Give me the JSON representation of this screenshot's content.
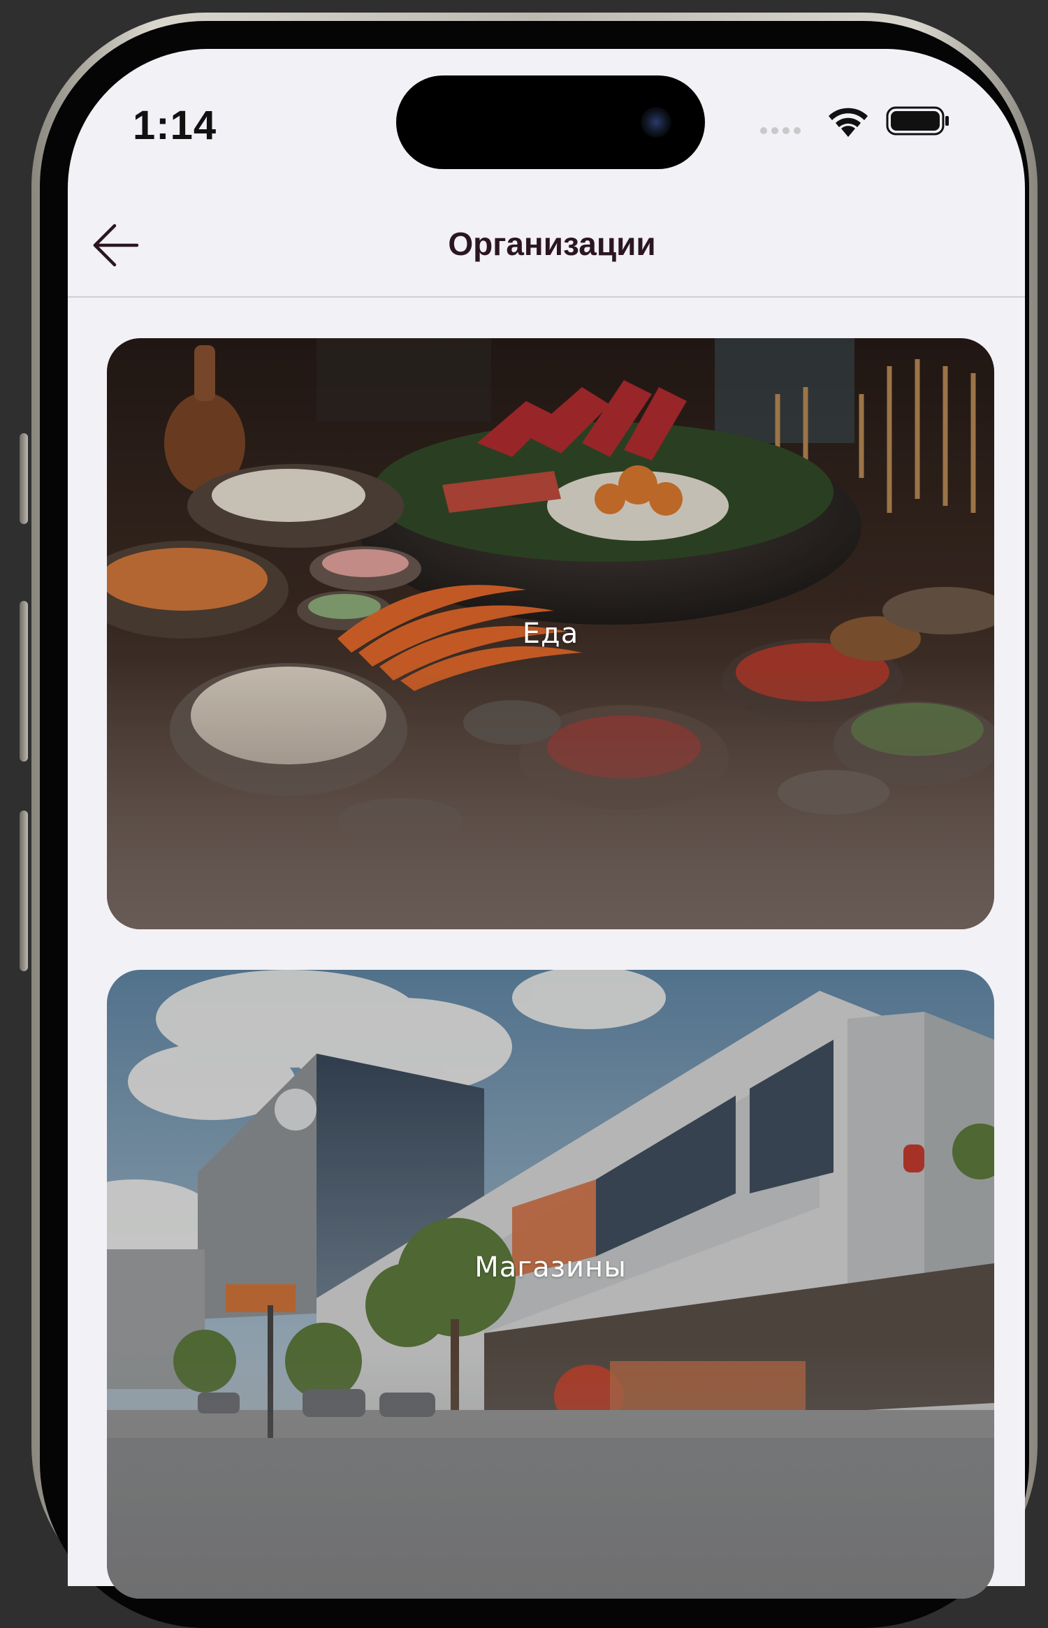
{
  "status_bar": {
    "time": "1:14"
  },
  "header": {
    "title": "Организации",
    "back_icon": "arrow-left-icon"
  },
  "categories": [
    {
      "label": "Еда",
      "image": "food-feast-photo"
    },
    {
      "label": "Магазины",
      "image": "shopping-mall-photo"
    }
  ],
  "colors": {
    "screen_background": "#f2f1f6",
    "title_text": "#2b1620",
    "card_label_text": "#ffffff"
  }
}
